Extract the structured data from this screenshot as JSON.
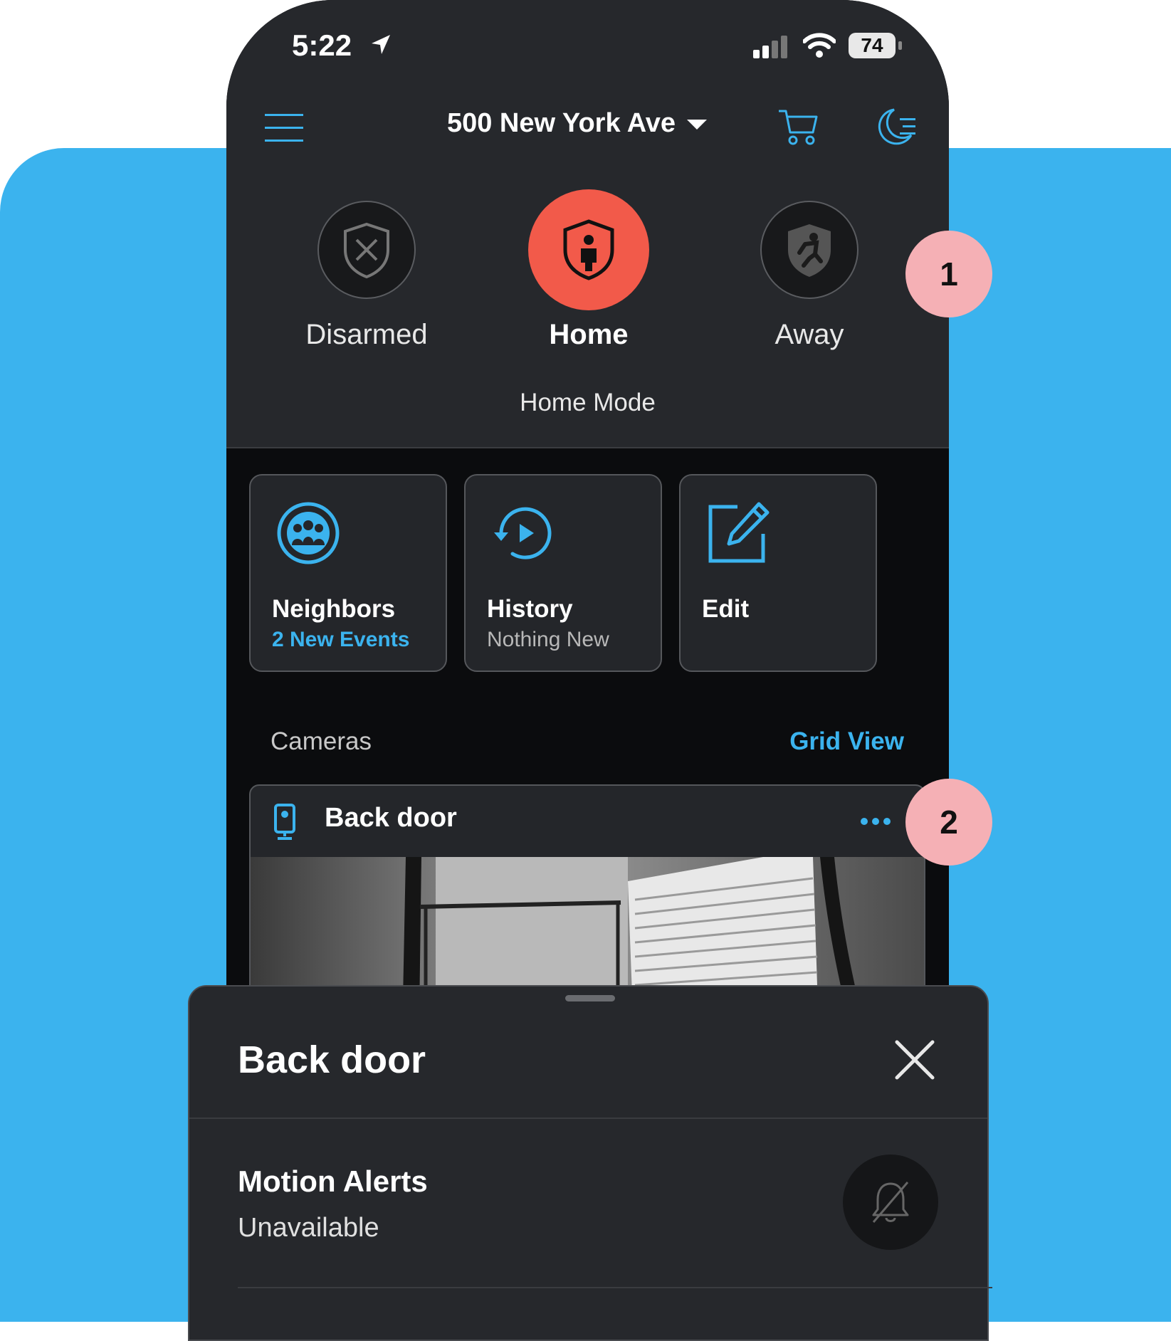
{
  "status_bar": {
    "time": "5:22",
    "battery": "74"
  },
  "header": {
    "address": "500 New York Ave"
  },
  "modes": {
    "items": [
      {
        "label": "Disarmed"
      },
      {
        "label": "Home"
      },
      {
        "label": "Away"
      }
    ],
    "active": "Home",
    "subtitle": "Home Mode"
  },
  "tiles": [
    {
      "title": "Neighbors",
      "subtitle": "2 New Events"
    },
    {
      "title": "History",
      "subtitle": "Nothing New"
    },
    {
      "title": "Edit",
      "subtitle": ""
    }
  ],
  "cameras": {
    "section_title": "Cameras",
    "view_link": "Grid View",
    "items": [
      {
        "name": "Back door"
      }
    ]
  },
  "callouts": [
    "1",
    "2"
  ],
  "sheet": {
    "title": "Back door",
    "motion_alerts": {
      "title": "Motion Alerts",
      "status": "Unavailable"
    }
  },
  "colors": {
    "accent": "#3bb3ee",
    "home_active": "#f25a4a",
    "background": "#26282c",
    "callout": "#f5b0b5"
  }
}
